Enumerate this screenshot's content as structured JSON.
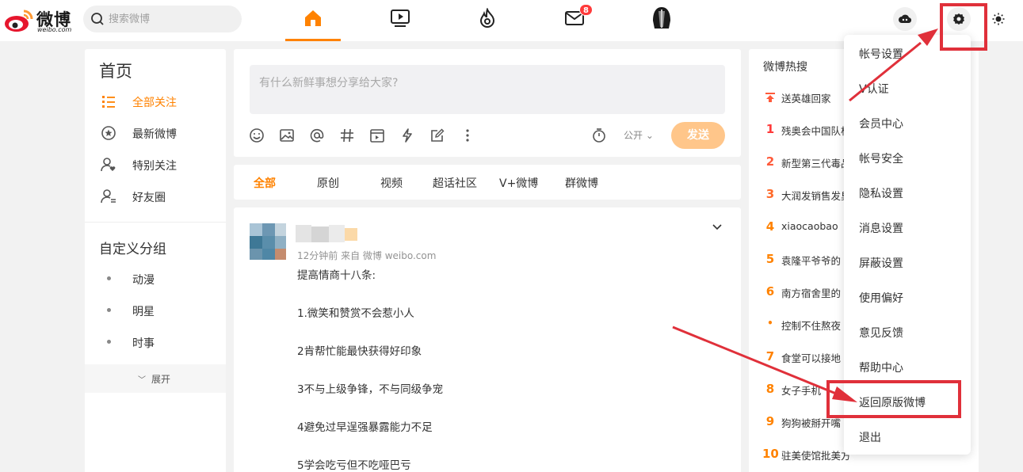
{
  "brand": {
    "name": "微博",
    "sub": "weibo.com"
  },
  "search": {
    "placeholder": "搜索微博"
  },
  "nav": {
    "mail_badge": "8"
  },
  "sidebar": {
    "title": "首页",
    "items": [
      {
        "label": "全部关注"
      },
      {
        "label": "最新微博"
      },
      {
        "label": "特别关注"
      },
      {
        "label": "好友圈"
      }
    ],
    "groups_title": "自定义分组",
    "groups": [
      {
        "label": "动漫"
      },
      {
        "label": "明星"
      },
      {
        "label": "时事"
      }
    ],
    "expand_label": "展开"
  },
  "composer": {
    "placeholder": "有什么新鲜事想分享给大家?",
    "visibility": "公开",
    "send_label": "发送"
  },
  "tabs": [
    "全部",
    "原创",
    "视频",
    "超话社区",
    "V+微博",
    "群微博"
  ],
  "post": {
    "meta": "12分钟前 来自 微博 weibo.com",
    "lines": [
      "提高情商十八条:",
      "1.微笑和赞赏不会惹小人",
      "2肯帮忙能最快获得好印象",
      "3不与上级争锋，不与同级争宠",
      "4避免过早逞强暴露能力不足",
      "5学会吃亏但不吃哑巴亏"
    ]
  },
  "hot": {
    "title": "微博热搜",
    "items": [
      {
        "rank": "",
        "text": "送英雄回家"
      },
      {
        "rank": "1",
        "text": "残奥会中国队根"
      },
      {
        "rank": "2",
        "text": "新型第三代毒品"
      },
      {
        "rank": "3",
        "text": "大润发销售发臭"
      },
      {
        "rank": "4",
        "text": "xiaocaobao"
      },
      {
        "rank": "5",
        "text": "袁隆平爷爷的"
      },
      {
        "rank": "6",
        "text": "南方宿舍里的"
      },
      {
        "rank": "•",
        "text": "控制不住熬夜"
      },
      {
        "rank": "7",
        "text": "食堂可以接地"
      },
      {
        "rank": "8",
        "text": "女子手机"
      },
      {
        "rank": "9",
        "text": "狗狗被掰开嘴"
      },
      {
        "rank": "10",
        "text": "驻美使馆批美方"
      }
    ]
  },
  "menu": {
    "items": [
      {
        "label": "帐号设置"
      },
      {
        "label": "V认证"
      },
      {
        "label": "会员中心"
      },
      {
        "label": "帐号安全"
      },
      {
        "label": "隐私设置"
      },
      {
        "label": "消息设置"
      },
      {
        "label": "屏蔽设置"
      },
      {
        "label": "使用偏好"
      },
      {
        "label": "意见反馈"
      },
      {
        "label": "帮助中心"
      },
      {
        "label": "返回原版微博"
      },
      {
        "label": "退出"
      }
    ]
  },
  "colors": {
    "accent": "#ff8200",
    "annotation": "#e0303a",
    "send_disabled": "#ffc68a"
  }
}
